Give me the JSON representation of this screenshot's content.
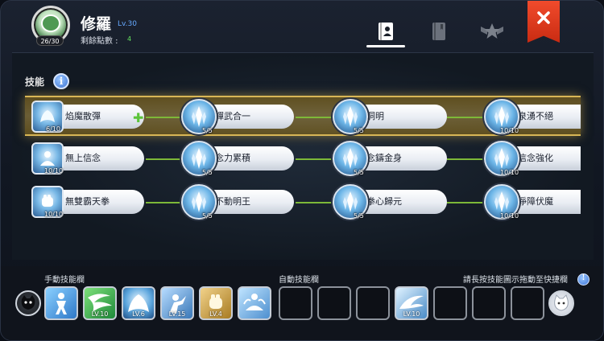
{
  "header": {
    "avatar_count": "26/30",
    "name": "修羅",
    "level": "Lv.30",
    "remaining_label": "剩餘點數 :",
    "remaining_value": "4",
    "tabs": [
      "skills-book-icon",
      "book-icon",
      "star-emblem-icon"
    ],
    "close_icon": "close-icon"
  },
  "skills": {
    "section_title": "技能",
    "rows": [
      {
        "nodes": [
          {
            "name": "焰魔散彈",
            "level": "6/10",
            "plus": "✚"
          },
          {
            "name": "禪武合一",
            "level": "5/5"
          },
          {
            "name": "洞明",
            "level": "5/5"
          },
          {
            "name": "泉湧不絕",
            "level": "10/10"
          }
        ]
      },
      {
        "nodes": [
          {
            "name": "無上信念",
            "level": "10/10"
          },
          {
            "name": "念力累積",
            "level": "5/5"
          },
          {
            "name": "念鑄金身",
            "level": "5/5"
          },
          {
            "name": "信念強化",
            "level": "10/10"
          }
        ]
      },
      {
        "nodes": [
          {
            "name": "無雙霸天拳",
            "level": "10/10"
          },
          {
            "name": "不動明王",
            "level": "5/5"
          },
          {
            "name": "拳心歸元",
            "level": "5/5"
          },
          {
            "name": "淨障伏魔",
            "level": "10/10"
          }
        ]
      }
    ]
  },
  "bottom": {
    "manual_label": "手動技能欄",
    "auto_label": "自動技能欄",
    "hint": "請長按技能圖示拖動至快捷欄",
    "manual_slots": [
      "",
      "LV.10",
      "LV.6",
      "LV.15",
      "LV.4",
      ""
    ],
    "auto_slots": [
      "",
      "",
      "",
      "LV.10",
      "",
      "",
      ""
    ]
  },
  "colors": {
    "accent_gold": "#d8b656",
    "connector_green": "#7db838",
    "close_red": "#e23b1e",
    "level_blue": "#66a9ff"
  }
}
